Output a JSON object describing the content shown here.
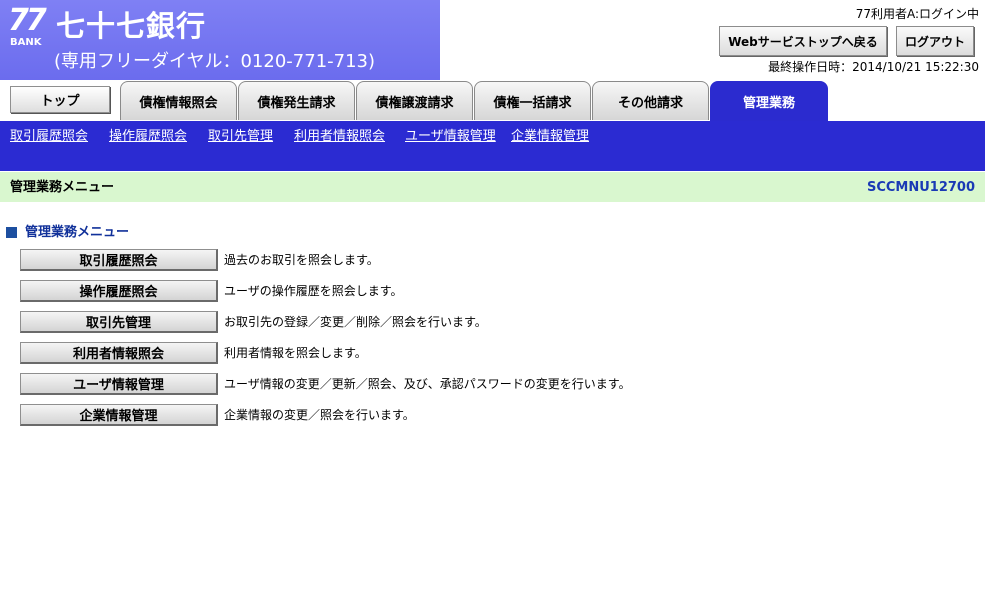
{
  "header": {
    "logo_number": "77",
    "logo_bank": "BANK",
    "bank_name": "七十七銀行",
    "phone": "(専用フリーダイヤル：0120-771-713)",
    "user_status": "77利用者A:ログイン中",
    "web_service_button": "Webサービストップへ戻る",
    "logout_button": "ログアウト",
    "last_operation": "最終操作日時：2014/10/21 15:22:30"
  },
  "tabs": {
    "top": "トップ",
    "items": [
      "債権情報照会",
      "債権発生請求",
      "債権譲渡請求",
      "債権一括請求",
      "その他請求",
      "管理業務"
    ],
    "active": "管理業務"
  },
  "submenu": [
    "取引履歴照会",
    "操作履歴照会",
    "取引先管理",
    "利用者情報照会",
    "ユーザ情報管理",
    "企業情報管理"
  ],
  "titlebar": {
    "title": "管理業務メニュー",
    "screen_id": "SCCMNU12700"
  },
  "section": {
    "heading": "管理業務メニュー",
    "items": [
      {
        "label": "取引履歴照会",
        "desc": "過去のお取引を照会します。"
      },
      {
        "label": "操作履歴照会",
        "desc": "ユーザの操作履歴を照会します。"
      },
      {
        "label": "取引先管理",
        "desc": "お取引先の登録／変更／削除／照会を行います。"
      },
      {
        "label": "利用者情報照会",
        "desc": "利用者情報を照会します。"
      },
      {
        "label": "ユーザ情報管理",
        "desc": "ユーザ情報の変更／更新／照会、及び、承認パスワードの変更を行います。"
      },
      {
        "label": "企業情報管理",
        "desc": "企業情報の変更／照会を行います。"
      }
    ]
  },
  "colors": {
    "logo_band": "#7f80f4",
    "nav_blue": "#2b2bd2",
    "title_bar": "#d9f7cf",
    "screen_id": "#1a3ab5"
  }
}
